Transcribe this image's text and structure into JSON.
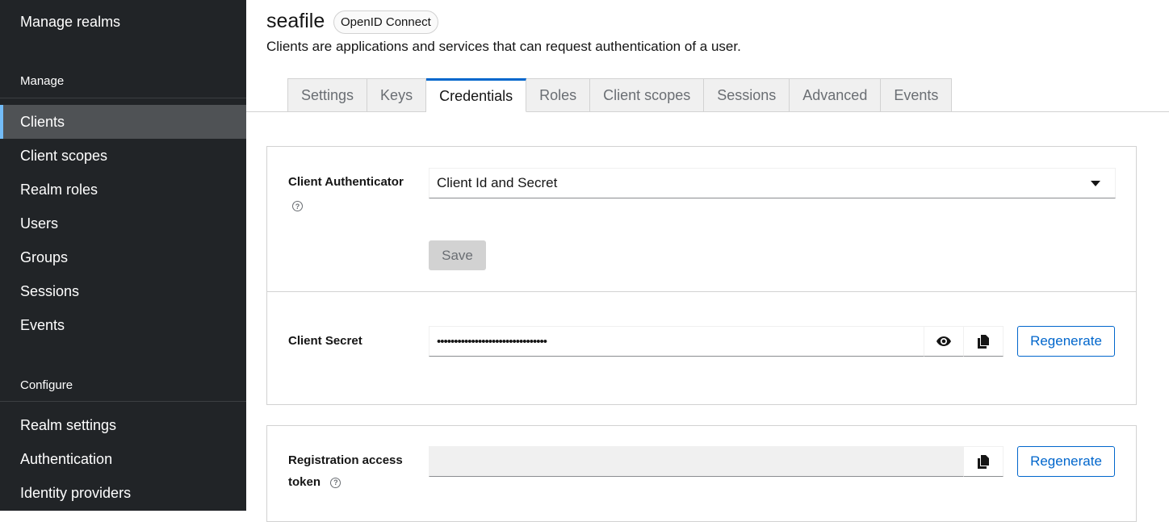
{
  "sidebar": {
    "manage_realms": "Manage realms",
    "manage_section": "Manage",
    "manage_items": [
      {
        "label": "Clients",
        "active": true
      },
      {
        "label": "Client scopes"
      },
      {
        "label": "Realm roles"
      },
      {
        "label": "Users"
      },
      {
        "label": "Groups"
      },
      {
        "label": "Sessions"
      },
      {
        "label": "Events"
      }
    ],
    "configure_section": "Configure",
    "configure_items": [
      {
        "label": "Realm settings"
      },
      {
        "label": "Authentication"
      },
      {
        "label": "Identity providers"
      }
    ]
  },
  "header": {
    "title": "seafile",
    "badge": "OpenID Connect",
    "subtitle": "Clients are applications and services that can request authentication of a user."
  },
  "tabs": [
    {
      "label": "Settings"
    },
    {
      "label": "Keys"
    },
    {
      "label": "Credentials",
      "active": true
    },
    {
      "label": "Roles"
    },
    {
      "label": "Client scopes"
    },
    {
      "label": "Sessions"
    },
    {
      "label": "Advanced"
    },
    {
      "label": "Events"
    }
  ],
  "authenticator": {
    "label": "Client Authenticator",
    "value": "Client Id and Secret",
    "save_label": "Save"
  },
  "secret": {
    "label": "Client Secret",
    "value": "••••••••••••••••••••••••••••••••",
    "regenerate_label": "Regenerate"
  },
  "registration": {
    "label_line1": "Registration access",
    "label_line2": "token",
    "value": "",
    "regenerate_label": "Regenerate"
  },
  "colors": {
    "sidebar_bg": "#212427",
    "active_item_bg": "#4f5255",
    "accent": "#0066cc",
    "active_indicator": "#73bcf7"
  },
  "icons": {
    "help": "question-circle-icon",
    "eye": "eye-icon",
    "copy": "copy-icon",
    "caret": "caret-down-icon"
  }
}
